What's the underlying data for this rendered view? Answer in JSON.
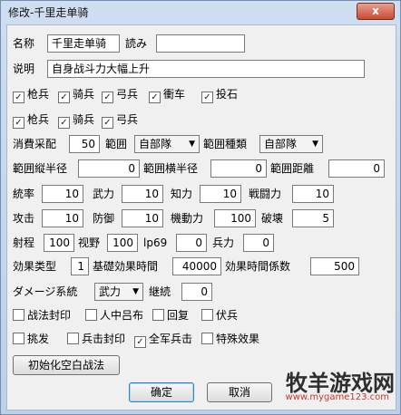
{
  "window": {
    "title": "修改-千里走单骑",
    "close_label": "x"
  },
  "row1": {
    "name_label": "名称",
    "name_value": "千里走单骑",
    "yomi_label": "読み",
    "yomi_value": ""
  },
  "row2": {
    "desc_label": "说明",
    "desc_value": "自身战斗力大幅上升"
  },
  "checks1": [
    {
      "label": "枪兵",
      "checked": true
    },
    {
      "label": "骑兵",
      "checked": true
    },
    {
      "label": "弓兵",
      "checked": true
    },
    {
      "label": "衝车",
      "checked": true
    },
    {
      "label": "投石",
      "checked": true
    }
  ],
  "checks2": [
    {
      "label": "枪兵",
      "checked": true
    },
    {
      "label": "骑兵",
      "checked": true
    },
    {
      "label": "弓兵",
      "checked": true
    }
  ],
  "row5": {
    "cost_label": "消費采配",
    "cost_value": "50",
    "range_label": "範囲",
    "range_value": "自部隊",
    "range_type_label": "範囲種類",
    "range_type_value": "自部隊"
  },
  "row6": {
    "v_radius_label": "範囲縦半径",
    "v_radius_value": "0",
    "h_radius_label": "範囲横半径",
    "h_radius_value": "0",
    "distance_label": "範囲距離",
    "distance_value": "0"
  },
  "row7": {
    "a_label": "統率",
    "a_value": "10",
    "b_label": "武力",
    "b_value": "10",
    "c_label": "知力",
    "c_value": "10",
    "d_label": "戦闘力",
    "d_value": "10"
  },
  "row8": {
    "a_label": "攻击",
    "a_value": "10",
    "b_label": "防御",
    "b_value": "10",
    "c_label": "機動力",
    "c_value": "100",
    "d_label": "破壊",
    "d_value": "5"
  },
  "row9": {
    "a_label": "射程",
    "a_value": "100",
    "b_label": "视野",
    "b_value": "100",
    "c_label": "lp69",
    "c_value": "0",
    "d_label": "兵力",
    "d_value": "0"
  },
  "row10": {
    "type_label": "効果类型",
    "type_value": "1",
    "base_label": "基礎効果時間",
    "base_value": "40000",
    "coef_label": "効果時間係数",
    "coef_value": "500"
  },
  "row11": {
    "dmg_label": "ダメージ系統",
    "dmg_value": "武力",
    "cont_label": "継続",
    "cont_value": "0"
  },
  "checks3": [
    {
      "label": "战法封印",
      "checked": false
    },
    {
      "label": "人中吕布",
      "checked": false
    },
    {
      "label": "回复",
      "checked": false
    },
    {
      "label": "伏兵",
      "checked": false
    }
  ],
  "checks4": [
    {
      "label": "挑发",
      "checked": false
    },
    {
      "label": "兵击封印",
      "checked": false
    },
    {
      "label": "全军兵击",
      "checked": true
    },
    {
      "label": "特殊效果",
      "checked": false
    }
  ],
  "buttons": {
    "init": "初始化空白战法",
    "ok": "确定",
    "cancel": "取消"
  },
  "watermark": {
    "text": "牧羊游戏网",
    "url": "www.mygame123.com"
  }
}
